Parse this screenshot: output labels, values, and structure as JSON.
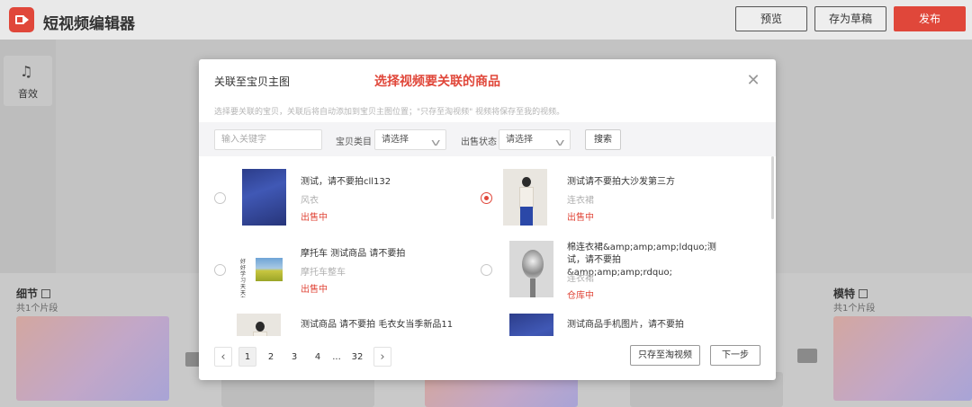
{
  "app": {
    "title": "短视频编辑器",
    "buttons": {
      "preview": "预览",
      "save_draft": "存为草稿",
      "publish": "发布"
    }
  },
  "left_panel": {
    "sound_effect_label": "音效"
  },
  "timeline": {
    "left_segment": {
      "title": "细节",
      "subtitle": "共1个片段"
    },
    "right_segment": {
      "title": "模特",
      "subtitle": "共1个片段"
    }
  },
  "modal": {
    "title": "关联至宝贝主图",
    "annotation": "选择视频要关联的商品",
    "description": "选择要关联的宝贝，关联后将自动添加到宝贝主图位置；\"只存至淘视频\" 视频将保存至我的视频。",
    "filters": {
      "keyword_placeholder": "输入关键字",
      "category_label": "宝贝类目",
      "category_value": "请选择",
      "status_label": "出售状态",
      "status_value": "请选择",
      "search_label": "搜索"
    },
    "products": [
      {
        "name": "测试，请不要拍cll132",
        "category": "风衣",
        "status": "出售中",
        "selected": false,
        "image": "blue-sweater"
      },
      {
        "name": "测试请不要拍大沙发第三方",
        "category": "连衣裙",
        "status": "出售中",
        "selected": true,
        "image": "white-sweater-model"
      },
      {
        "name": "摩托车 测试商品 请不要拍",
        "category": "摩托车整车",
        "status": "出售中",
        "selected": false,
        "image": "landscape-product",
        "image_text": "好好学习天天向上"
      },
      {
        "name": "棉连衣裙&amp;amp;amp;ldquo;测试，请不要拍&amp;amp;amp;rdquo;",
        "category": "连衣裙",
        "status": "仓库中",
        "selected": false,
        "image": "flower-bouquet"
      },
      {
        "name": "测试商品 请不要拍 毛衣女当季新品11",
        "category": "",
        "status": "",
        "selected": false,
        "image": "model"
      },
      {
        "name": "测试商品手机图片，请不要拍",
        "category": "",
        "status": "",
        "selected": false,
        "image": "blue-sweater"
      }
    ],
    "pagination": {
      "pages": [
        "1",
        "2",
        "3",
        "4",
        "...",
        "32"
      ],
      "current": "1"
    },
    "buttons": {
      "save_taobao_only": "只存至淘视频",
      "next": "下一步"
    },
    "colors": {
      "accent": "#e0473a"
    }
  }
}
